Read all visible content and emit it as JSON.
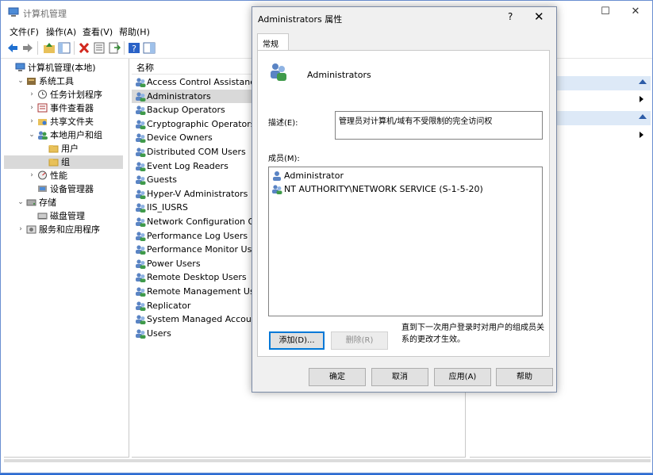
{
  "window": {
    "title": "计算机管理"
  },
  "menu": [
    "文件(F)",
    "操作(A)",
    "查看(V)",
    "帮助(H)"
  ],
  "tree": [
    {
      "label": "计算机管理(本地)",
      "indent": 0,
      "expander": "",
      "icon": "computer-icon"
    },
    {
      "label": "系统工具",
      "indent": 1,
      "expander": "v",
      "icon": "tools-icon"
    },
    {
      "label": "任务计划程序",
      "indent": 2,
      "expander": ">",
      "icon": "clock-icon"
    },
    {
      "label": "事件查看器",
      "indent": 2,
      "expander": ">",
      "icon": "event-viewer-icon"
    },
    {
      "label": "共享文件夹",
      "indent": 2,
      "expander": ">",
      "icon": "shared-folder-icon"
    },
    {
      "label": "本地用户和组",
      "indent": 2,
      "expander": "v",
      "icon": "users-icon"
    },
    {
      "label": "用户",
      "indent": 3,
      "expander": "",
      "icon": "folder-icon"
    },
    {
      "label": "组",
      "indent": 3,
      "expander": "",
      "icon": "folder-icon",
      "selected": true
    },
    {
      "label": "性能",
      "indent": 2,
      "expander": ">",
      "icon": "performance-icon"
    },
    {
      "label": "设备管理器",
      "indent": 2,
      "expander": "",
      "icon": "device-manager-icon"
    },
    {
      "label": "存储",
      "indent": 1,
      "expander": "v",
      "icon": "storage-icon"
    },
    {
      "label": "磁盘管理",
      "indent": 2,
      "expander": "",
      "icon": "disk-icon"
    },
    {
      "label": "服务和应用程序",
      "indent": 1,
      "expander": ">",
      "icon": "services-icon"
    }
  ],
  "list": {
    "header": "名称",
    "items": [
      "Access Control Assistance Operators",
      "Administrators",
      "Backup Operators",
      "Cryptographic Operators",
      "Device Owners",
      "Distributed COM Users",
      "Event Log Readers",
      "Guests",
      "Hyper-V Administrators",
      "IIS_IUSRS",
      "Network Configuration Operators",
      "Performance Log Users",
      "Performance Monitor Users",
      "Power Users",
      "Remote Desktop Users",
      "Remote Management Users",
      "Replicator",
      "System Managed Accounts Group",
      "Users"
    ],
    "selected_index": 1
  },
  "dialog": {
    "title": "Administrators 属性",
    "help": "?",
    "close": "✕",
    "tab": "常规",
    "group_name": "Administrators",
    "description_label": "描述(E):",
    "description": "管理员对计算机/域有不受限制的完全访问权",
    "members_label": "成员(M):",
    "members": [
      {
        "name": "Administrator",
        "icon": "user-icon"
      },
      {
        "name": "NT AUTHORITY\\NETWORK SERVICE (S-1-5-20)",
        "icon": "group-icon"
      }
    ],
    "add_button": "添加(D)...",
    "remove_button": "删除(R)",
    "note": "直到下一次用户登录时对用户的组成员关系的更改才生效。",
    "ok_button": "确定",
    "cancel_button": "取消",
    "apply_button": "应用(A)",
    "help_button": "帮助"
  },
  "colors": {
    "accent": "#0078d7",
    "selection": "#d9d9d9",
    "actions_header": "#dde9f7"
  }
}
